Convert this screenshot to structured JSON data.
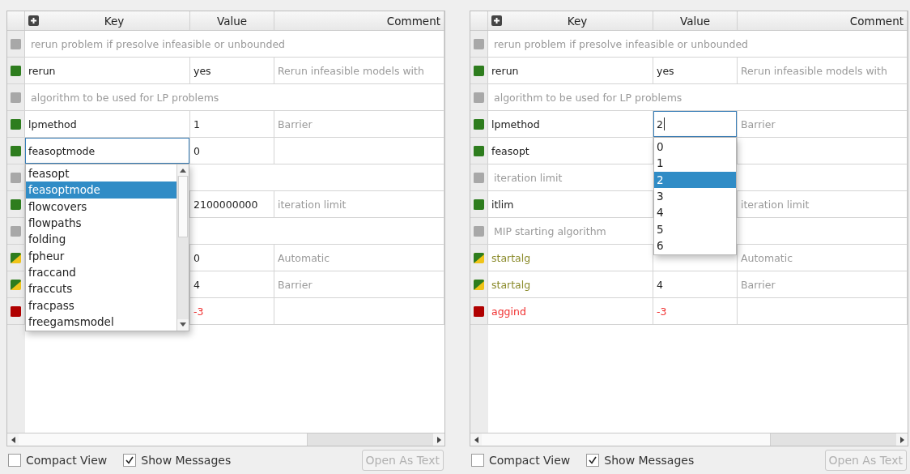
{
  "panels": [
    {
      "columns": [
        "Key",
        "Value",
        "Comment"
      ],
      "rows": [
        {
          "kind": "comment",
          "text": "rerun problem if presolve infeasible or unbounded"
        },
        {
          "kind": "option",
          "key": "rerun",
          "value": "yes",
          "comment": "Rerun infeasible models with"
        },
        {
          "kind": "comment",
          "text": "algorithm to be used for LP problems"
        },
        {
          "kind": "option",
          "key": "lpmethod",
          "value": "1",
          "comment": "Barrier"
        },
        {
          "kind": "option",
          "key": "feasoptmode",
          "value": "0",
          "key_editing": true,
          "value_editing": false
        },
        {
          "kind": "comment"
        },
        {
          "kind": "option",
          "value": "2100000000",
          "comment": "iteration limit"
        },
        {
          "kind": "comment"
        },
        {
          "kind": "deprecated",
          "value": "0",
          "comment": "Automatic"
        },
        {
          "kind": "deprecated",
          "value": "4",
          "comment": "Barrier"
        },
        {
          "kind": "error",
          "value": "-3"
        }
      ],
      "popup": {
        "scrollbar": true,
        "items": [
          {
            "label": "feasopt",
            "selected": false
          },
          {
            "label": "feasoptmode",
            "selected": true
          },
          {
            "label": "flowcovers",
            "selected": false
          },
          {
            "label": "flowpaths",
            "selected": false
          },
          {
            "label": "folding",
            "selected": false
          },
          {
            "label": "fpheur",
            "selected": false
          },
          {
            "label": "fraccand",
            "selected": false
          },
          {
            "label": "fraccuts",
            "selected": false
          },
          {
            "label": "fracpass",
            "selected": false
          },
          {
            "label": "freegamsmodel",
            "selected": false
          }
        ]
      },
      "footer": {
        "checkboxes": [
          {
            "label": "Compact View",
            "checked": false
          },
          {
            "label": "Show Messages",
            "checked": true
          }
        ],
        "button": {
          "label": "Open As Text",
          "disabled": true
        }
      }
    },
    {
      "columns": [
        "Key",
        "Value",
        "Comment"
      ],
      "rows": [
        {
          "kind": "comment",
          "text": "rerun problem if presolve infeasible or unbounded"
        },
        {
          "kind": "option",
          "key": "rerun",
          "value": "yes",
          "comment": "Rerun infeasible models with"
        },
        {
          "kind": "comment",
          "text": "algorithm to be used for LP problems"
        },
        {
          "kind": "option",
          "key": "lpmethod",
          "value": "2",
          "comment": "Barrier",
          "key_editing": false,
          "value_editing": true
        },
        {
          "kind": "option",
          "key": "feasopt"
        },
        {
          "kind": "comment",
          "text": "iteration limit"
        },
        {
          "kind": "option",
          "key": "itlim",
          "comment": "iteration limit"
        },
        {
          "kind": "comment",
          "text": "MIP starting algorithm"
        },
        {
          "kind": "deprecated",
          "key": "startalg",
          "comment": "Automatic"
        },
        {
          "kind": "deprecated",
          "key": "startalg",
          "value": "4",
          "comment": "Barrier"
        },
        {
          "kind": "error",
          "key": "aggind",
          "value": "-3"
        }
      ],
      "popup": {
        "scrollbar": false,
        "items": [
          {
            "label": "0",
            "selected": false
          },
          {
            "label": "1",
            "selected": false
          },
          {
            "label": "2",
            "selected": true
          },
          {
            "label": "3",
            "selected": false
          },
          {
            "label": "4",
            "selected": false
          },
          {
            "label": "5",
            "selected": false
          },
          {
            "label": "6",
            "selected": false
          }
        ]
      },
      "footer": {
        "checkboxes": [
          {
            "label": "Compact View",
            "checked": false
          },
          {
            "label": "Show Messages",
            "checked": true
          }
        ],
        "button": {
          "label": "Open As Text",
          "disabled": true
        }
      }
    }
  ]
}
